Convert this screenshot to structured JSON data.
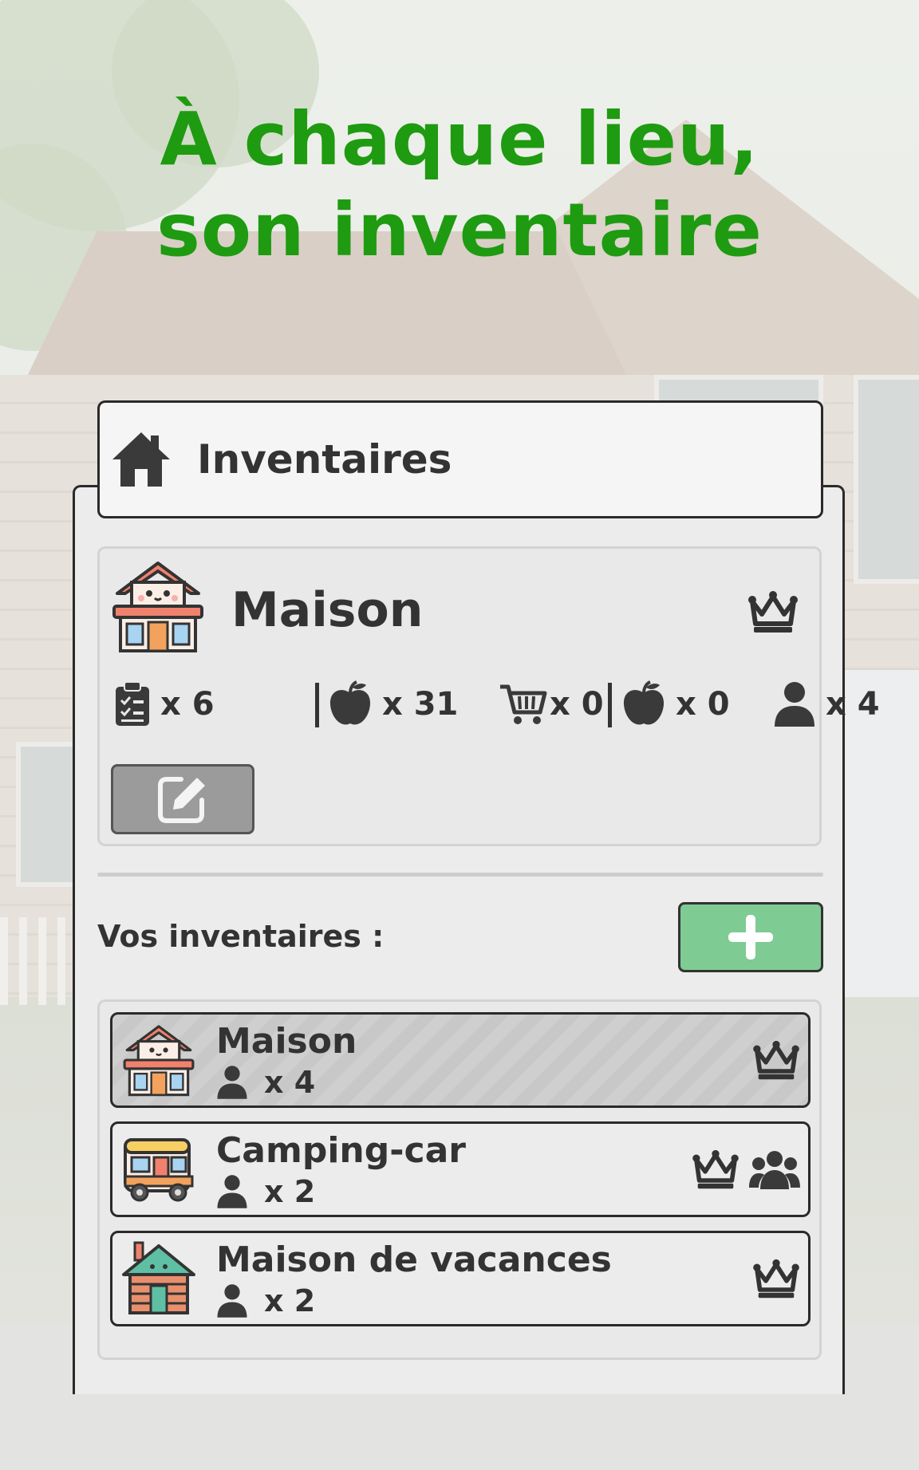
{
  "headline": {
    "line1": "À chaque lieu,",
    "line2": "son inventaire"
  },
  "header": {
    "title": "Inventaires"
  },
  "current": {
    "name": "Maison",
    "stats": [
      {
        "icon": "clipboard-icon",
        "value": "x 6"
      },
      {
        "icon": "apple-icon",
        "value": "x 31"
      },
      {
        "icon": "cart-icon",
        "value": "x 0"
      },
      {
        "icon": "apple-icon",
        "value": "x 0"
      },
      {
        "icon": "person-icon",
        "value": "x 4"
      }
    ]
  },
  "section": {
    "label": "Vos inventaires :"
  },
  "inventories": [
    {
      "name": "Maison",
      "members": "x 4",
      "icon": "house-icon",
      "owner": true,
      "shared": false,
      "active": true
    },
    {
      "name": "Camping-car",
      "members": "x 2",
      "icon": "camper-van-icon",
      "owner": true,
      "shared": true,
      "active": false
    },
    {
      "name": "Maison de vacances",
      "members": "x 2",
      "icon": "cabin-icon",
      "owner": true,
      "shared": false,
      "active": false
    }
  ],
  "colors": {
    "headline": "#1e9b10",
    "add_button": "#7fcb94",
    "text": "#333333"
  }
}
